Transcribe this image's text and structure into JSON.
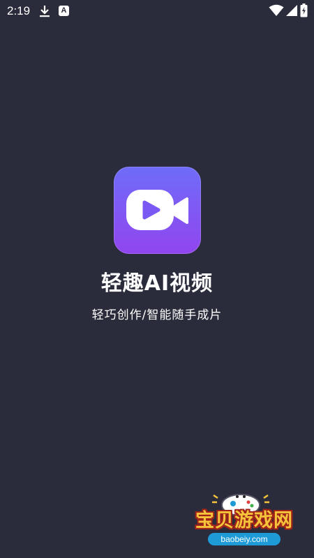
{
  "status_bar": {
    "time": "2:19",
    "icons": [
      "download-icon",
      "a-badge-icon",
      "wifi-icon",
      "signal-icon",
      "battery-icon"
    ],
    "a_badge": "A"
  },
  "splash": {
    "app_icon": "video-camera-play-icon",
    "title": "轻趣AI视频",
    "slogan": "轻巧创作/智能随手成片"
  },
  "watermark": {
    "title": "宝贝游戏网",
    "domain": "baobeiy.com"
  },
  "colors": {
    "background": "#2b2c3b",
    "icon_gradient_top": "#6f6cf9",
    "icon_gradient_bottom": "#9145ee",
    "text": "#ffffff",
    "watermark_gold": "#f5c43a",
    "watermark_blue": "#1e9bd7"
  }
}
